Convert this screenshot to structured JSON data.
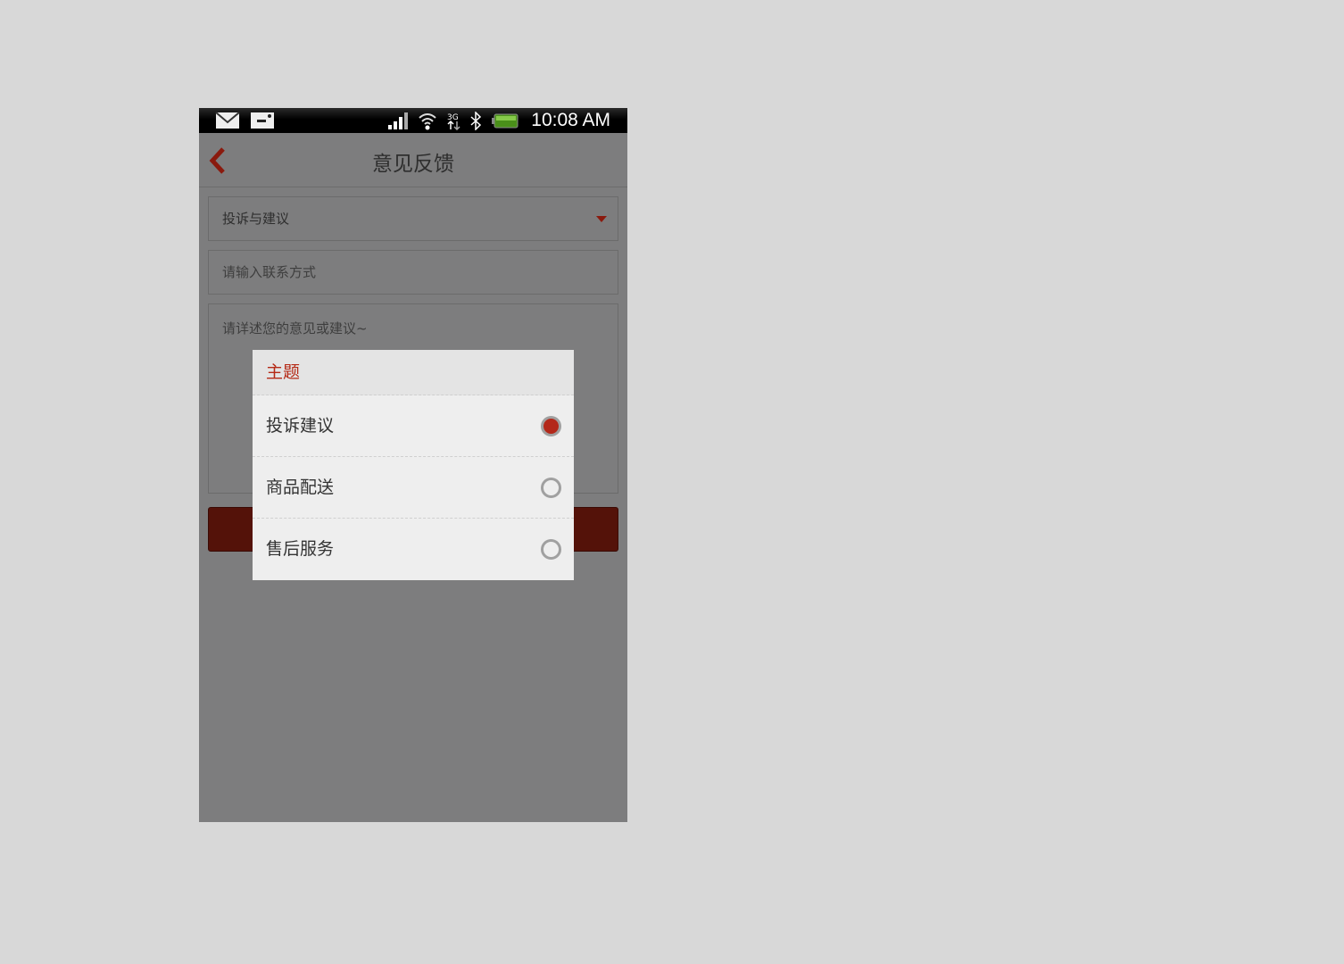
{
  "status_bar": {
    "time": "10:08 AM",
    "icons": [
      "mail-icon",
      "sd-card-icon",
      "signal-icon",
      "wifi-icon",
      "3g-icon",
      "bluetooth-icon",
      "battery-icon"
    ]
  },
  "header": {
    "title": "意见反馈",
    "back_icon": "chevron-left-icon"
  },
  "form": {
    "category_value": "投诉与建议",
    "contact_placeholder": "请输入联系方式",
    "detail_placeholder": "请详述您的意见或建议~"
  },
  "dialog": {
    "title": "主题",
    "options": [
      {
        "label": "投诉建议",
        "selected": true
      },
      {
        "label": "商品配送",
        "selected": false
      },
      {
        "label": "售后服务",
        "selected": false
      }
    ]
  },
  "colors": {
    "accent": "#b3281a",
    "button": "#541209"
  }
}
